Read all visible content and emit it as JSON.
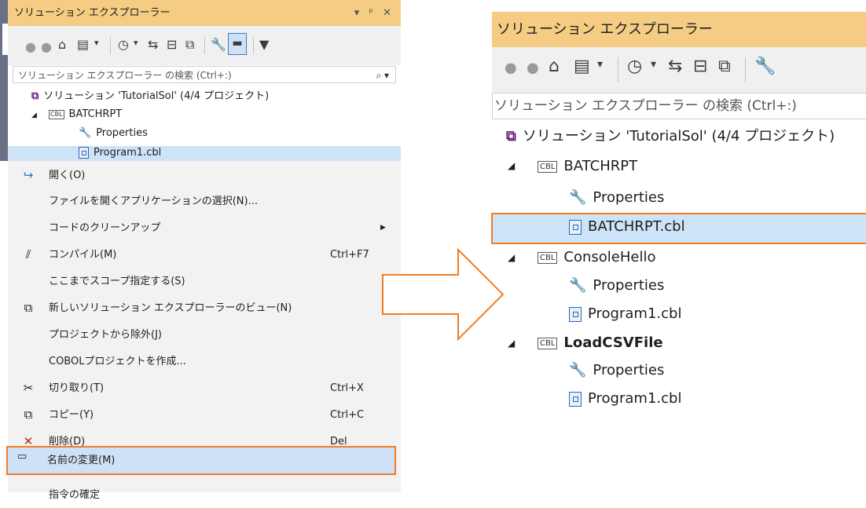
{
  "left": {
    "title": "ソリューション エクスプローラー",
    "title_controls": "▾ ⁿ ✕",
    "search_placeholder": "ソリューション エクスプローラー の検索 (Ctrl+:)",
    "tree": [
      {
        "label": "ソリューション 'TutorialSol' (4/4 プロジェクト)",
        "icon": "solution-icon"
      },
      {
        "label": "BATCHRPT",
        "icon": "cbl-project-icon"
      },
      {
        "label": "Properties",
        "icon": "wrench-icon"
      },
      {
        "label": "Program1.cbl",
        "icon": "cobol-file-icon"
      }
    ],
    "cbl_badge": "CBL"
  },
  "context_menu": {
    "items": [
      {
        "label": "開く(O)",
        "shortcut": "",
        "icon": "open-arrow-icon"
      },
      {
        "label": "ファイルを開くアプリケーションの選択(N)...",
        "shortcut": "",
        "icon": ""
      },
      {
        "label": "コードのクリーンアップ",
        "shortcut": "",
        "icon": "",
        "submenu": true
      },
      {
        "label": "コンパイル(M)",
        "shortcut": "Ctrl+F7",
        "icon": "compile-icon"
      },
      {
        "label": "ここまでスコープ指定する(S)",
        "shortcut": "",
        "icon": ""
      },
      {
        "label": "新しいソリューション エクスプローラーのビュー(N)",
        "shortcut": "",
        "icon": "new-view-icon"
      },
      {
        "label": "プロジェクトから除外(J)",
        "shortcut": "",
        "icon": ""
      },
      {
        "label": "COBOLプロジェクトを作成...",
        "shortcut": "",
        "icon": ""
      },
      {
        "label": "切り取り(T)",
        "shortcut": "Ctrl+X",
        "icon": "cut-icon"
      },
      {
        "label": "コピー(Y)",
        "shortcut": "Ctrl+C",
        "icon": "copy-icon"
      },
      {
        "label": "削除(D)",
        "shortcut": "Del",
        "icon": "delete-icon"
      },
      {
        "label": "名前の変更(M)",
        "shortcut": "",
        "icon": "rename-icon",
        "highlighted": true
      },
      {
        "label": "指令の確定",
        "shortcut": "",
        "icon": ""
      }
    ]
  },
  "right": {
    "title": "ソリューション エクスプローラー",
    "search_placeholder": "ソリューション エクスプローラー の検索 (Ctrl+:)",
    "tree": [
      {
        "label": "ソリューション 'TutorialSol' (4/4 プロジェクト)",
        "icon": "solution-icon"
      },
      {
        "label": "BATCHRPT",
        "icon": "cbl-project-icon"
      },
      {
        "label": "Properties",
        "icon": "wrench-icon"
      },
      {
        "label": "BATCHRPT.cbl",
        "icon": "cobol-file-icon",
        "selected": true
      },
      {
        "label": "ConsoleHello",
        "icon": "cbl-project-icon"
      },
      {
        "label": "Properties",
        "icon": "wrench-icon"
      },
      {
        "label": "Program1.cbl",
        "icon": "cobol-file-icon"
      },
      {
        "label": "LoadCSVFile",
        "icon": "cbl-project-icon",
        "bold": true
      },
      {
        "label": "Properties",
        "icon": "wrench-icon"
      },
      {
        "label": "Program1.cbl",
        "icon": "cobol-file-icon"
      }
    ],
    "cbl_badge": "CBL"
  },
  "colors": {
    "title_bar": "#f5cc84",
    "highlight_border": "#f07d22",
    "selection": "#cce3f8"
  }
}
